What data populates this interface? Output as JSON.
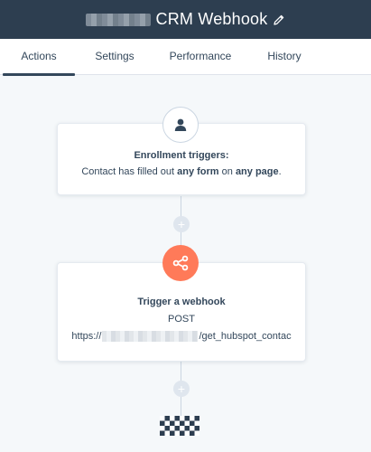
{
  "header": {
    "title": "CRM Webhook",
    "edit_icon": "pencil-icon"
  },
  "tabs": [
    {
      "label": "Actions",
      "active": true
    },
    {
      "label": "Settings",
      "active": false
    },
    {
      "label": "Performance",
      "active": false
    },
    {
      "label": "History",
      "active": false
    }
  ],
  "enrollment": {
    "icon": "user-icon",
    "title": "Enrollment triggers:",
    "text_prefix": "Contact has filled out ",
    "text_bold_1": "any form",
    "text_mid": " on ",
    "text_bold_2": "any page",
    "text_suffix": "."
  },
  "webhook_action": {
    "icon": "webhook-icon",
    "title": "Trigger a webhook",
    "method": "POST",
    "url_prefix": "https://",
    "url_suffix": "/get_hubspot_contac"
  },
  "add_action": {
    "symbol": "+"
  },
  "end_marker": {
    "icon": "checkered-flag-icon"
  },
  "colors": {
    "header_bg": "#2d3e50",
    "accent": "#ff7a59",
    "text": "#33475b",
    "canvas_bg": "#f5f8fa"
  }
}
